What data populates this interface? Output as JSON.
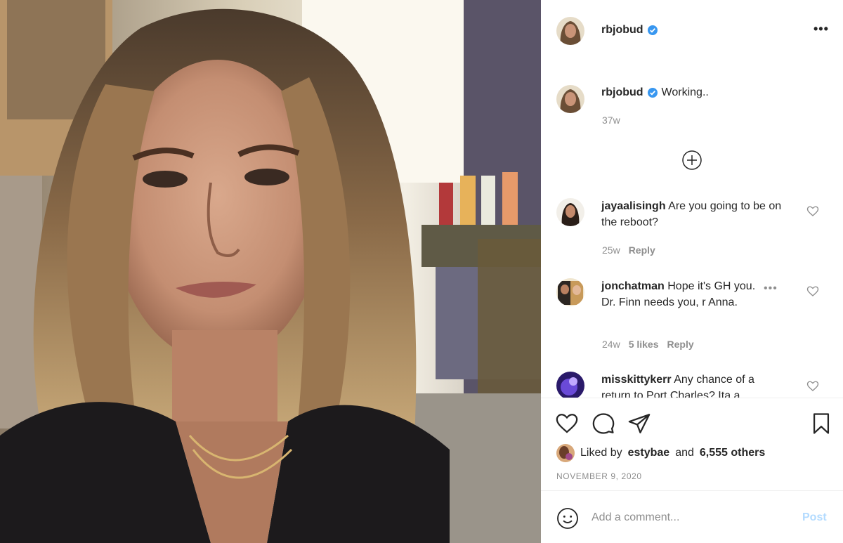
{
  "post": {
    "username": "rbjobud",
    "verified": true,
    "more_icon": "more-horizontal-icon"
  },
  "caption": {
    "username": "rbjobud",
    "text": "Working..",
    "time": "37w"
  },
  "load_more_icon": "plus-circle-icon",
  "comments": [
    {
      "username": "jayaalisingh",
      "text": "Are you going to be on the reboot?",
      "time": "25w",
      "likes": "",
      "reply": "Reply"
    },
    {
      "username": "jonchatman",
      "text": "Hope it's GH you. Dr. Finn needs you, r Anna.",
      "time": "24w",
      "likes": "5 likes",
      "reply": "Reply"
    },
    {
      "username": "misskittykerr",
      "text": "Any chance of a return to Port Charles? Ita a",
      "time": "",
      "likes": "",
      "reply": ""
    }
  ],
  "actions": {
    "like_icon": "heart-icon",
    "comment_icon": "comment-icon",
    "share_icon": "paper-plane-icon",
    "save_icon": "bookmark-icon"
  },
  "likes": {
    "prefix": "Liked by",
    "user": "estybae",
    "and": "and",
    "others": "6,555 others"
  },
  "date": "NOVEMBER 9, 2020",
  "add_comment": {
    "placeholder": "Add a comment...",
    "post_label": "Post",
    "emoji_icon": "smiley-icon"
  },
  "colors": {
    "verified": "#3897f0",
    "muted": "#8e8e8e",
    "post_disabled": "#b3dbff",
    "text": "#262626"
  }
}
